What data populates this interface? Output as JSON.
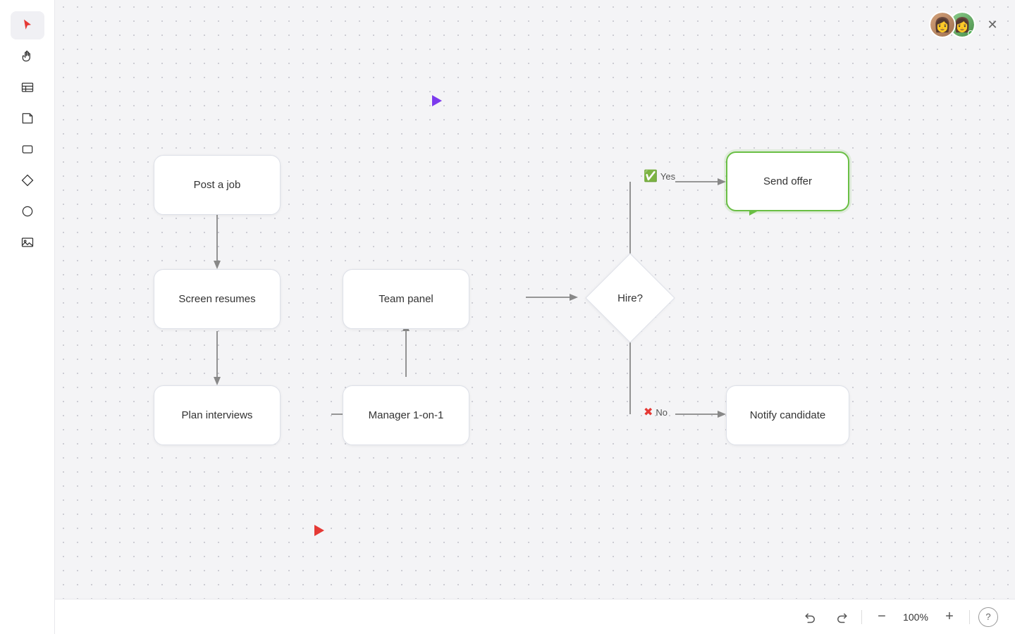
{
  "toolbar": {
    "zoom_label": "100%",
    "undo_label": "undo",
    "redo_label": "redo",
    "zoom_in_label": "+",
    "zoom_out_label": "−",
    "help_label": "?"
  },
  "nodes": {
    "post_job": "Post a job",
    "screen_resumes": "Screen resumes",
    "plan_interviews": "Plan interviews",
    "team_panel": "Team panel",
    "manager_1on1": "Manager 1-on-1",
    "hire_question": "Hire?",
    "send_offer": "Send offer",
    "notify_candidate": "Notify candidate"
  },
  "labels": {
    "yes": "Yes",
    "no": "No"
  },
  "sidebar": {
    "icons": [
      {
        "name": "pointer-icon",
        "symbol": "▶"
      },
      {
        "name": "hand-icon",
        "symbol": "✋"
      },
      {
        "name": "table-icon",
        "symbol": "▤"
      },
      {
        "name": "sticky-note-icon",
        "symbol": "🗒"
      },
      {
        "name": "rectangle-icon",
        "symbol": "☐"
      },
      {
        "name": "diamond-icon",
        "symbol": "◇"
      },
      {
        "name": "circle-icon",
        "symbol": "○"
      },
      {
        "name": "image-icon",
        "symbol": "🖼"
      }
    ]
  },
  "avatars": {
    "user1": "👩",
    "user2": "👩"
  }
}
